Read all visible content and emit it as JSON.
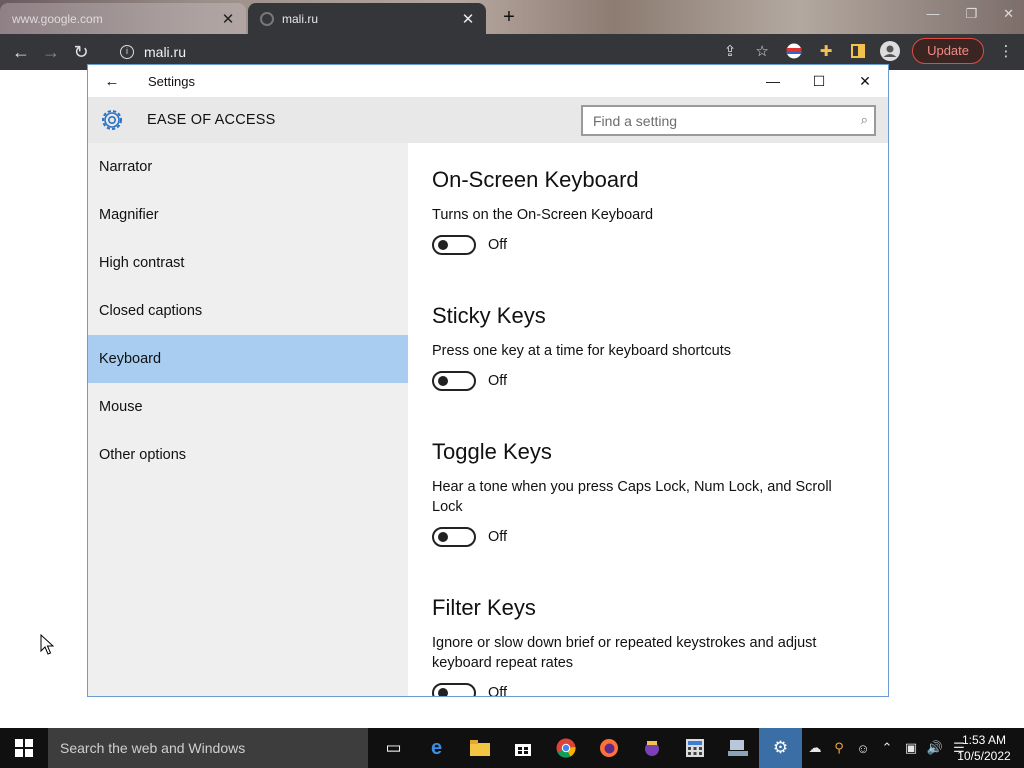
{
  "browser": {
    "tabs": [
      {
        "title": "www.google.com",
        "close": "✕"
      },
      {
        "title": "mali.ru",
        "close": "✕"
      }
    ],
    "new_tab": "+",
    "url": "mali.ru",
    "update_label": "Update"
  },
  "settings": {
    "window_title": "Settings",
    "section_title": "EASE OF ACCESS",
    "search_placeholder": "Find a setting",
    "sidebar": [
      {
        "label": "Narrator",
        "selected": false
      },
      {
        "label": "Magnifier",
        "selected": false
      },
      {
        "label": "High contrast",
        "selected": false
      },
      {
        "label": "Closed captions",
        "selected": false
      },
      {
        "label": "Keyboard",
        "selected": true
      },
      {
        "label": "Mouse",
        "selected": false
      },
      {
        "label": "Other options",
        "selected": false
      }
    ],
    "sections": [
      {
        "title": "On-Screen Keyboard",
        "description": "Turns on the On-Screen Keyboard",
        "state": "Off"
      },
      {
        "title": "Sticky Keys",
        "description": "Press one key at a time for keyboard shortcuts",
        "state": "Off"
      },
      {
        "title": "Toggle Keys",
        "description": "Hear a tone when you press Caps Lock, Num Lock, and Scroll Lock",
        "state": "Off"
      },
      {
        "title": "Filter Keys",
        "description": "Ignore or slow down brief or repeated keystrokes and adjust keyboard repeat rates",
        "state": "Off"
      }
    ]
  },
  "taskbar": {
    "search_text": "Search the web and Windows",
    "time": "1:53 AM",
    "date": "10/5/2022"
  },
  "colors": {
    "selected_item": "#a8cdf0",
    "update_accent": "#e04b3f",
    "active_taskbar": "#3a6ea5"
  }
}
